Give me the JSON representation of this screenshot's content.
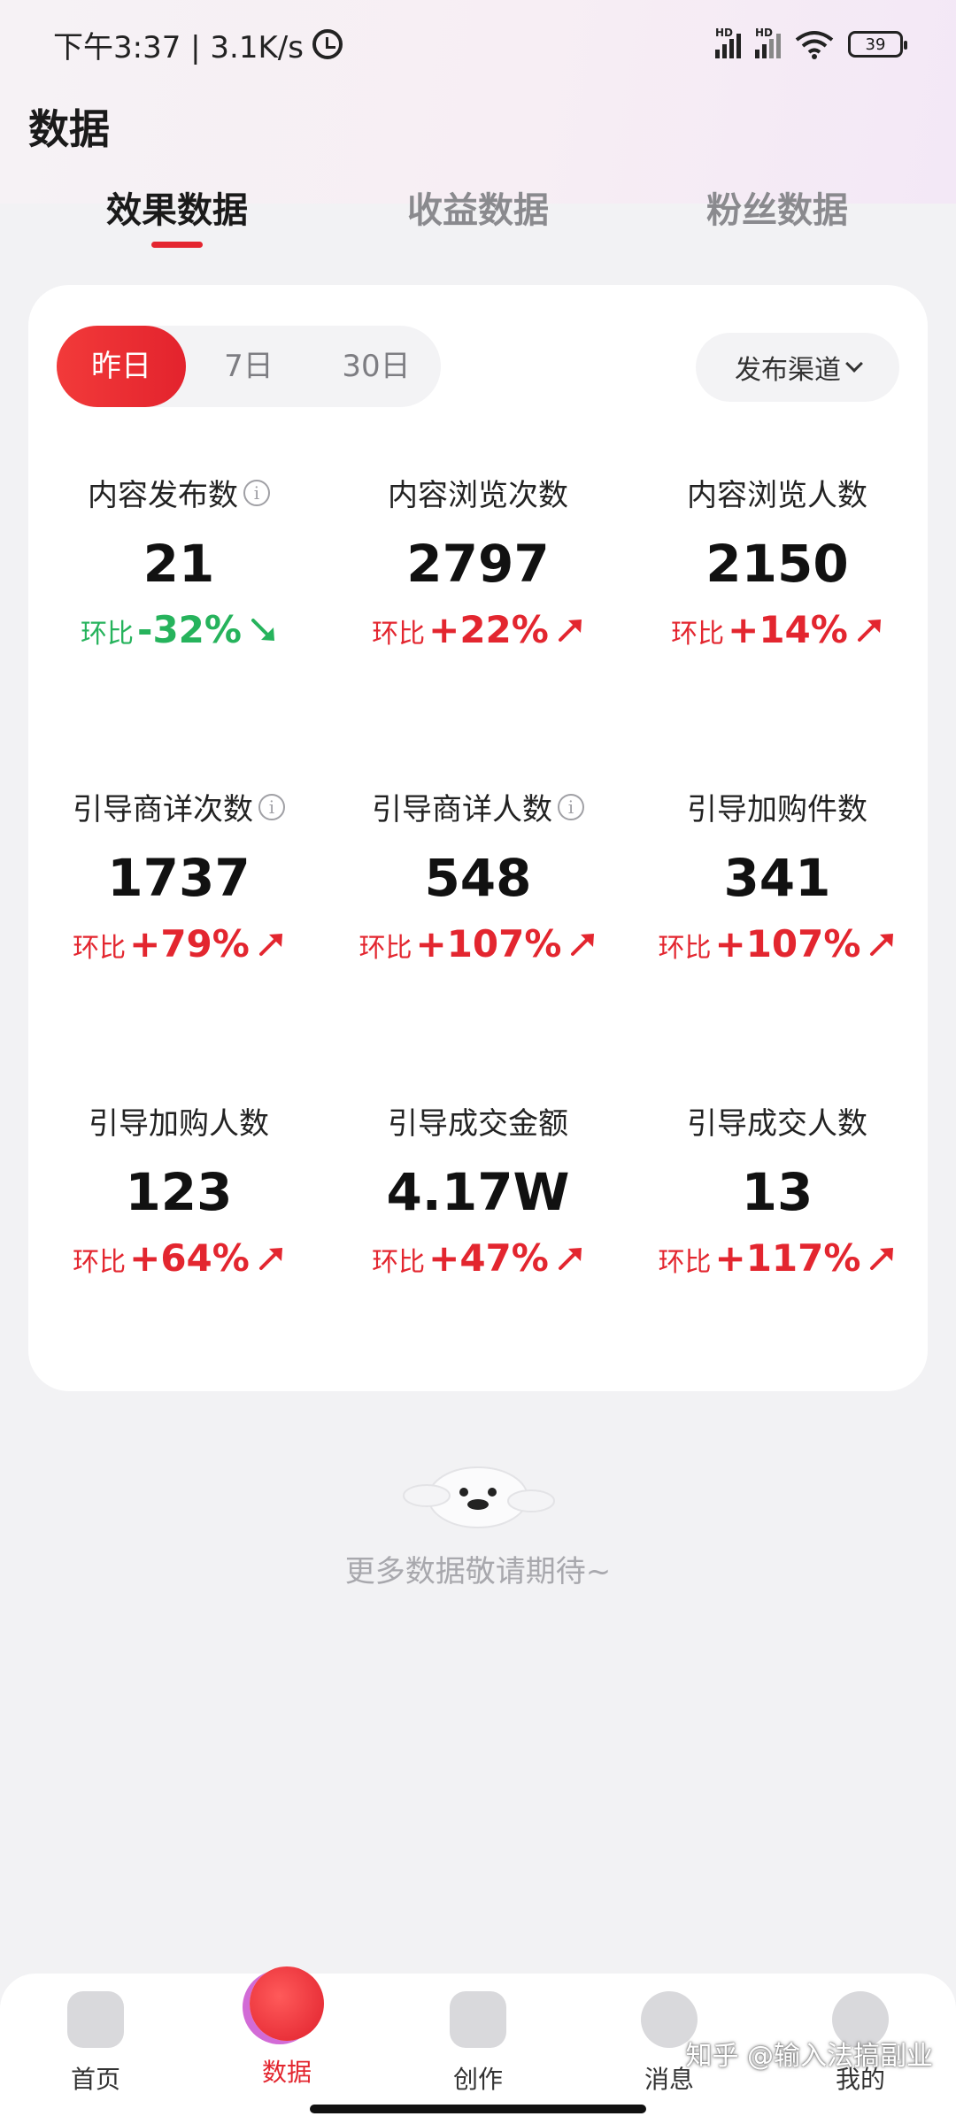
{
  "status_bar": {
    "time_speed": "下午3:37 | 3.1K/s",
    "battery": "39",
    "network_badge": "HD"
  },
  "page_title": "数据",
  "tabs": [
    {
      "label": "效果数据",
      "active": true
    },
    {
      "label": "收益数据",
      "active": false
    },
    {
      "label": "粉丝数据",
      "active": false
    }
  ],
  "period": {
    "options": [
      "昨日",
      "7日",
      "30日"
    ],
    "selected": "昨日"
  },
  "channel_filter": "发布渠道",
  "change_prefix": "环比",
  "metrics": [
    {
      "label": "内容发布数",
      "value": "21",
      "change": "-32%",
      "trend": "down",
      "info": true
    },
    {
      "label": "内容浏览次数",
      "value": "2797",
      "change": "+22%",
      "trend": "up",
      "info": false
    },
    {
      "label": "内容浏览人数",
      "value": "2150",
      "change": "+14%",
      "trend": "up",
      "info": false
    },
    {
      "label": "引导商详次数",
      "value": "1737",
      "change": "+79%",
      "trend": "up",
      "info": true
    },
    {
      "label": "引导商详人数",
      "value": "548",
      "change": "+107%",
      "trend": "up",
      "info": true
    },
    {
      "label": "引导加购件数",
      "value": "341",
      "change": "+107%",
      "trend": "up",
      "info": false
    },
    {
      "label": "引导加购人数",
      "value": "123",
      "change": "+64%",
      "trend": "up",
      "info": false
    },
    {
      "label": "引导成交金额",
      "value": "4.17W",
      "change": "+47%",
      "trend": "up",
      "info": false
    },
    {
      "label": "引导成交人数",
      "value": "13",
      "change": "+117%",
      "trend": "up",
      "info": false
    }
  ],
  "empty_state": "更多数据敬请期待~",
  "bottom_nav": [
    {
      "label": "首页",
      "icon": "home-icon",
      "active": false
    },
    {
      "label": "数据",
      "icon": "data-icon",
      "active": true
    },
    {
      "label": "创作",
      "icon": "create-icon",
      "active": false
    },
    {
      "label": "消息",
      "icon": "message-icon",
      "active": false
    },
    {
      "label": "我的",
      "icon": "profile-icon",
      "active": false
    }
  ],
  "watermark": "知乎 @输入法搞副业",
  "colors": {
    "accent": "#e3262f",
    "positive_change": "#e3262f",
    "negative_change": "#26b35c",
    "background": "#f2f2f4"
  }
}
